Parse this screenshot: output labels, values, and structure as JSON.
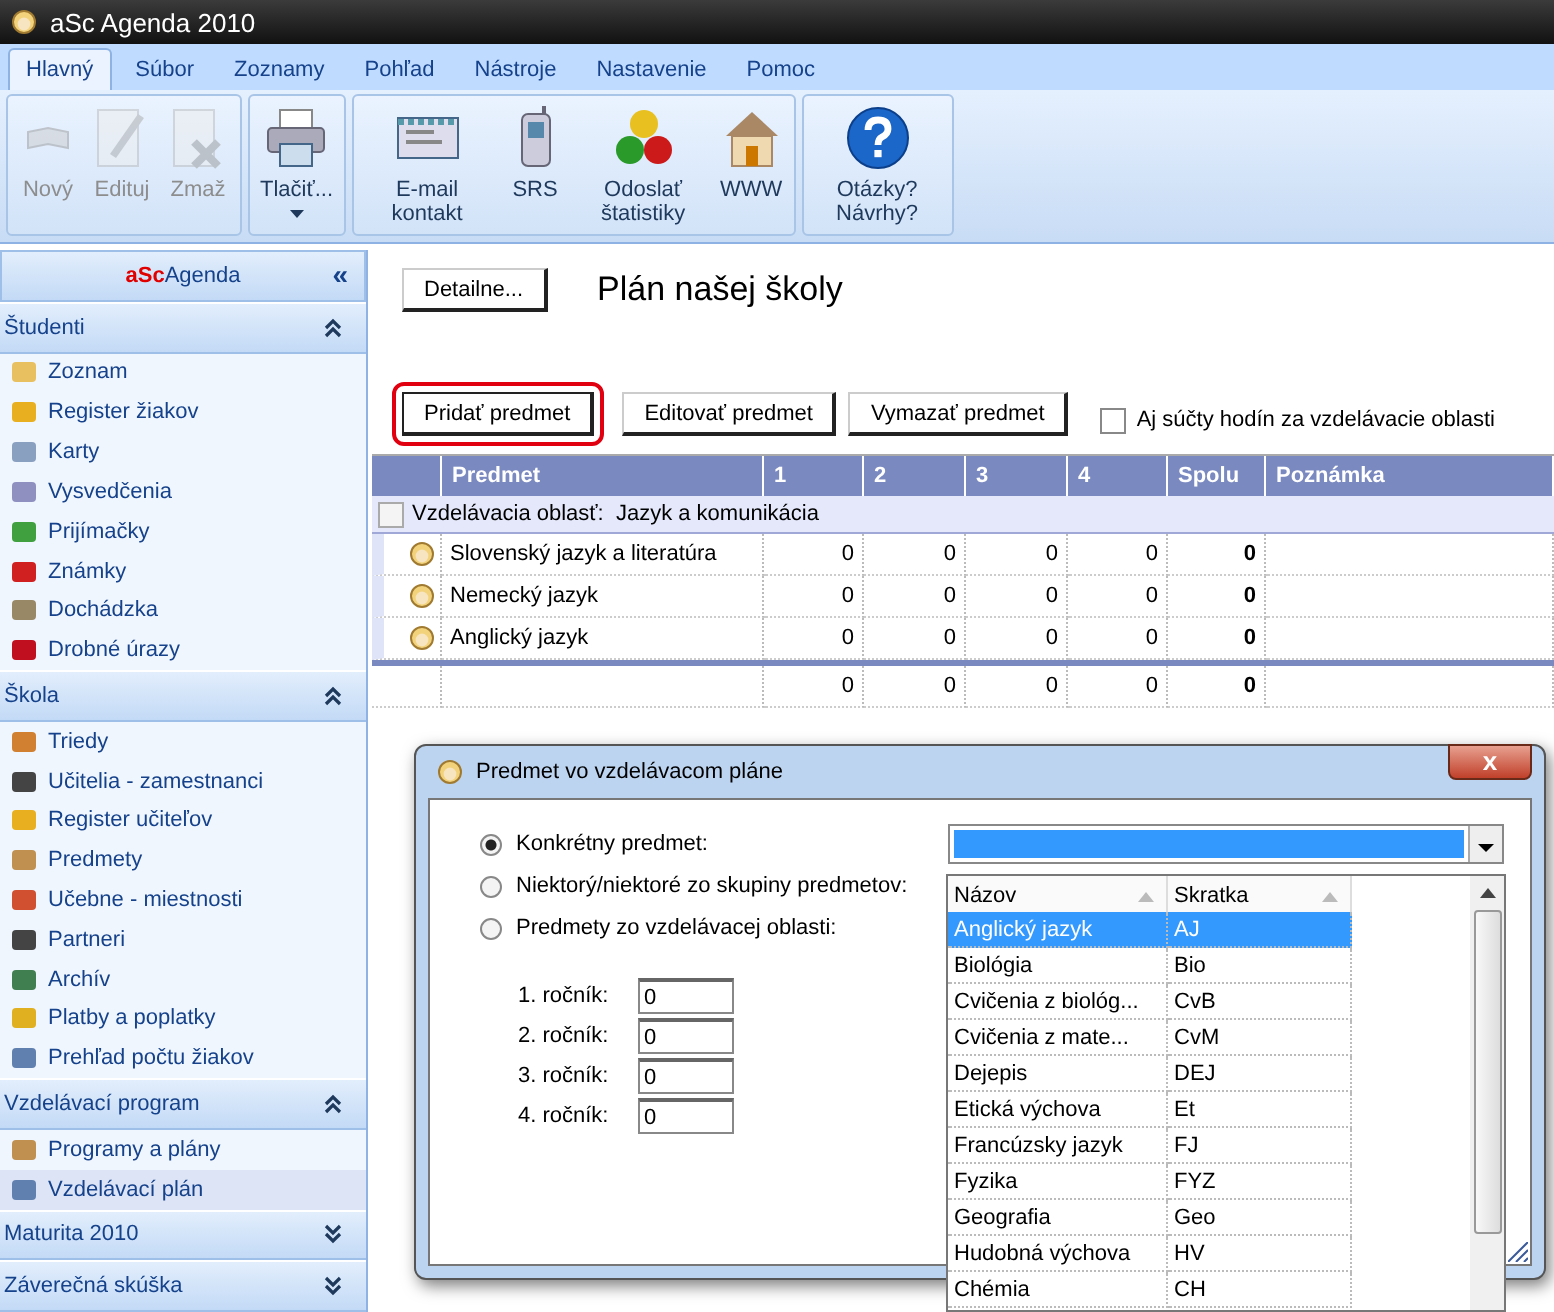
{
  "window": {
    "title": "aSc Agenda 2010"
  },
  "menu_tabs": [
    {
      "label": "Hlavný",
      "selected": true
    },
    {
      "label": "Súbor",
      "selected": false
    },
    {
      "label": "Zoznamy",
      "selected": false
    },
    {
      "label": "Pohľad",
      "selected": false
    },
    {
      "label": "Nástroje",
      "selected": false
    },
    {
      "label": "Nastavenie",
      "selected": false
    },
    {
      "label": "Pomoc",
      "selected": false
    }
  ],
  "ribbon_groups": [
    {
      "buttons": [
        {
          "label": "Nový",
          "disabled": true
        },
        {
          "label": "Edituj",
          "disabled": true
        },
        {
          "label": "Zmaž",
          "disabled": true
        }
      ]
    },
    {
      "buttons": [
        {
          "label": "Tlačiť...",
          "disabled": false,
          "dropdown": true
        }
      ]
    },
    {
      "buttons": [
        {
          "label": "E-mail kontakt",
          "disabled": false
        },
        {
          "label": "SRS",
          "disabled": false
        },
        {
          "label": "Odoslať štatistiky",
          "disabled": false
        },
        {
          "label": "WWW",
          "disabled": false
        }
      ]
    },
    {
      "buttons": [
        {
          "label": "Otázky? Návrhy?",
          "disabled": false
        }
      ]
    }
  ],
  "sidebar": {
    "brand_prefix": "aSc",
    "brand_rest": "Agenda",
    "collapse": "«",
    "sections": [
      {
        "title": "Študenti",
        "expanded": true,
        "items": [
          {
            "label": "Zoznam",
            "selected": false
          },
          {
            "label": "Register žiakov",
            "selected": false
          },
          {
            "label": "Karty",
            "selected": false
          },
          {
            "label": "Vysvedčenia",
            "selected": false
          },
          {
            "label": "Prijímačky",
            "selected": false
          },
          {
            "label": "Známky",
            "selected": false
          },
          {
            "label": "Dochádzka",
            "selected": false
          },
          {
            "label": "Drobné úrazy",
            "selected": false
          }
        ]
      },
      {
        "title": "Škola",
        "expanded": true,
        "items": [
          {
            "label": "Triedy",
            "selected": false
          },
          {
            "label": "Učitelia - zamestnanci",
            "selected": false
          },
          {
            "label": "Register učiteľov",
            "selected": false
          },
          {
            "label": "Predmety",
            "selected": false
          },
          {
            "label": "Učebne - miestnosti",
            "selected": false
          },
          {
            "label": "Partneri",
            "selected": false
          },
          {
            "label": "Archív",
            "selected": false
          },
          {
            "label": "Platby a poplatky",
            "selected": false
          },
          {
            "label": "Prehľad počtu žiakov",
            "selected": false
          }
        ]
      },
      {
        "title": "Vzdelávací program",
        "expanded": true,
        "items": [
          {
            "label": "Programy a plány",
            "selected": false
          },
          {
            "label": "Vzdelávací plán",
            "selected": true
          }
        ]
      },
      {
        "title": "Maturita 2010",
        "expanded": false
      },
      {
        "title": "Záverečná skúška",
        "expanded": false
      }
    ]
  },
  "content": {
    "detail_button": "Detailne...",
    "plan_title": "Plán našej školy",
    "actions": [
      {
        "label": "Pridať predmet",
        "highlighted": true
      },
      {
        "label": "Editovať predmet",
        "highlighted": false
      },
      {
        "label": "Vymazať predmet",
        "highlighted": false
      }
    ],
    "sum_checkbox": {
      "label": "Aj súčty hodín za vzdelávacie oblasti",
      "checked": false
    },
    "table": {
      "columns": [
        "Predmet",
        "1",
        "2",
        "3",
        "4",
        "Spolu",
        "Poznámka"
      ],
      "group": {
        "label": "Vzdelávacia oblasť:  Jazyk a komunikácia"
      },
      "rows": [
        {
          "name": "Slovenský jazyk a literatúra",
          "values": [
            "0",
            "0",
            "0",
            "0"
          ],
          "total": "0"
        },
        {
          "name": "Nemecký jazyk",
          "values": [
            "0",
            "0",
            "0",
            "0"
          ],
          "total": "0"
        },
        {
          "name": "Anglický jazyk",
          "values": [
            "0",
            "0",
            "0",
            "0"
          ],
          "total": "0"
        }
      ],
      "totals": {
        "values": [
          "0",
          "0",
          "0",
          "0"
        ],
        "total": "0"
      }
    }
  },
  "dialog": {
    "title": "Predmet vo vzdelávacom pláne",
    "close": "x",
    "options": [
      {
        "label": "Konkrétny predmet:",
        "selected": true
      },
      {
        "label": "Niektorý/niektoré zo skupiny predmetov:",
        "selected": false
      },
      {
        "label": "Predmety zo vzdelávacej oblasti:",
        "selected": false
      }
    ],
    "year_fields": [
      {
        "label": "1. ročník:",
        "value": "0"
      },
      {
        "label": "2. ročník:",
        "value": "0"
      },
      {
        "label": "3. ročník:",
        "value": "0"
      },
      {
        "label": "4. ročník:",
        "value": "0"
      }
    ],
    "dropdown": {
      "columns": [
        "Názov",
        "Skratka"
      ],
      "rows": [
        {
          "name": "Anglický jazyk",
          "abbr": "AJ",
          "selected": true
        },
        {
          "name": "Biológia",
          "abbr": "Bio",
          "selected": false
        },
        {
          "name": "Cvičenia z biológ...",
          "abbr": "CvB",
          "selected": false
        },
        {
          "name": "Cvičenia z mate...",
          "abbr": "CvM",
          "selected": false
        },
        {
          "name": "Dejepis",
          "abbr": "DEJ",
          "selected": false
        },
        {
          "name": "Etická výchova",
          "abbr": "Et",
          "selected": false
        },
        {
          "name": "Francúzsky jazyk",
          "abbr": "FJ",
          "selected": false
        },
        {
          "name": "Fyzika",
          "abbr": "FYZ",
          "selected": false
        },
        {
          "name": "Geografia",
          "abbr": "Geo",
          "selected": false
        },
        {
          "name": "Hudobná výchova",
          "abbr": "HV",
          "selected": false
        },
        {
          "name": "Chémia",
          "abbr": "CH",
          "selected": false
        }
      ]
    }
  }
}
